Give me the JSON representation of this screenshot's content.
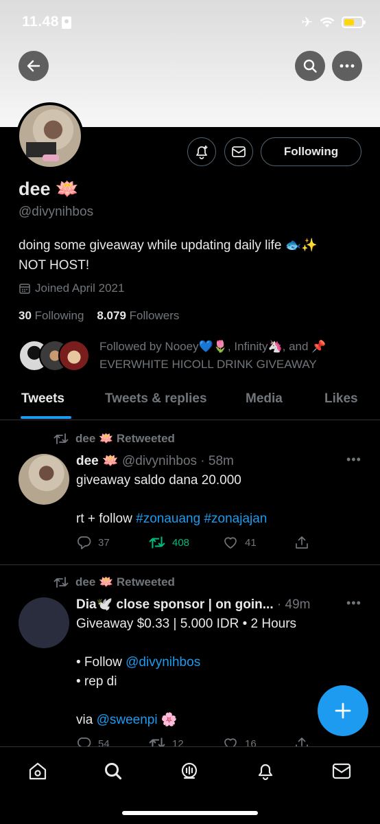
{
  "status_bar": {
    "time": "11.48"
  },
  "profile": {
    "name": "dee 🪷",
    "handle": "@divynihbos",
    "bio_line1": "doing some giveaway while updating daily life 🐟✨",
    "bio_line2": "NOT HOST!",
    "joined": "Joined April 2021",
    "following_count": "30",
    "following_label": "Following",
    "followers_count": "8.079",
    "followers_label": "Followers",
    "followed_by_line1": "Followed by Nooey💙🌷, Infinity🦄, and 📌",
    "followed_by_line2": "EVERWHITE HICOLL DRINK GIVEAWAY",
    "follow_button": "Following"
  },
  "tabs": [
    "Tweets",
    "Tweets & replies",
    "Media",
    "Likes"
  ],
  "tweets": [
    {
      "retweeted_by": "dee 🪷 Retweeted",
      "display_name": "dee 🪷",
      "handle_time": "@divynihbos · 58m",
      "line1": "giveaway saldo dana 20.000",
      "line3_prefix": "rt + follow ",
      "hashtag1": "#zonauang",
      "hashtag2": "#zonajajan",
      "replies": "37",
      "retweets": "408",
      "likes": "41"
    },
    {
      "retweeted_by": "dee 🪷 Retweeted",
      "display_name": "Dia🕊️ close sponsor | on goin...",
      "handle_time": "· 49m",
      "line1": "Giveaway $0.33 | 5.000 IDR • 2 Hours",
      "line3_prefix": "• Follow ",
      "mention1": "@divynihbos",
      "line4": "• rep di",
      "line6_prefix": "via ",
      "mention2": "@sweenpi",
      "line6_suffix": " 🌸",
      "replies": "54",
      "retweets": "12",
      "likes": "16"
    }
  ],
  "colors": {
    "accent": "#1d9bf0",
    "retweet_green": "#00ba7c",
    "muted": "#71767b"
  },
  "icons": [
    "back-arrow-icon",
    "search-icon",
    "more-icon",
    "notification-plus-icon",
    "mail-icon",
    "calendar-icon",
    "retweet-icon",
    "reply-icon",
    "like-icon",
    "share-icon",
    "compose-plus-icon",
    "home-icon",
    "spaces-icon",
    "bell-icon"
  ]
}
